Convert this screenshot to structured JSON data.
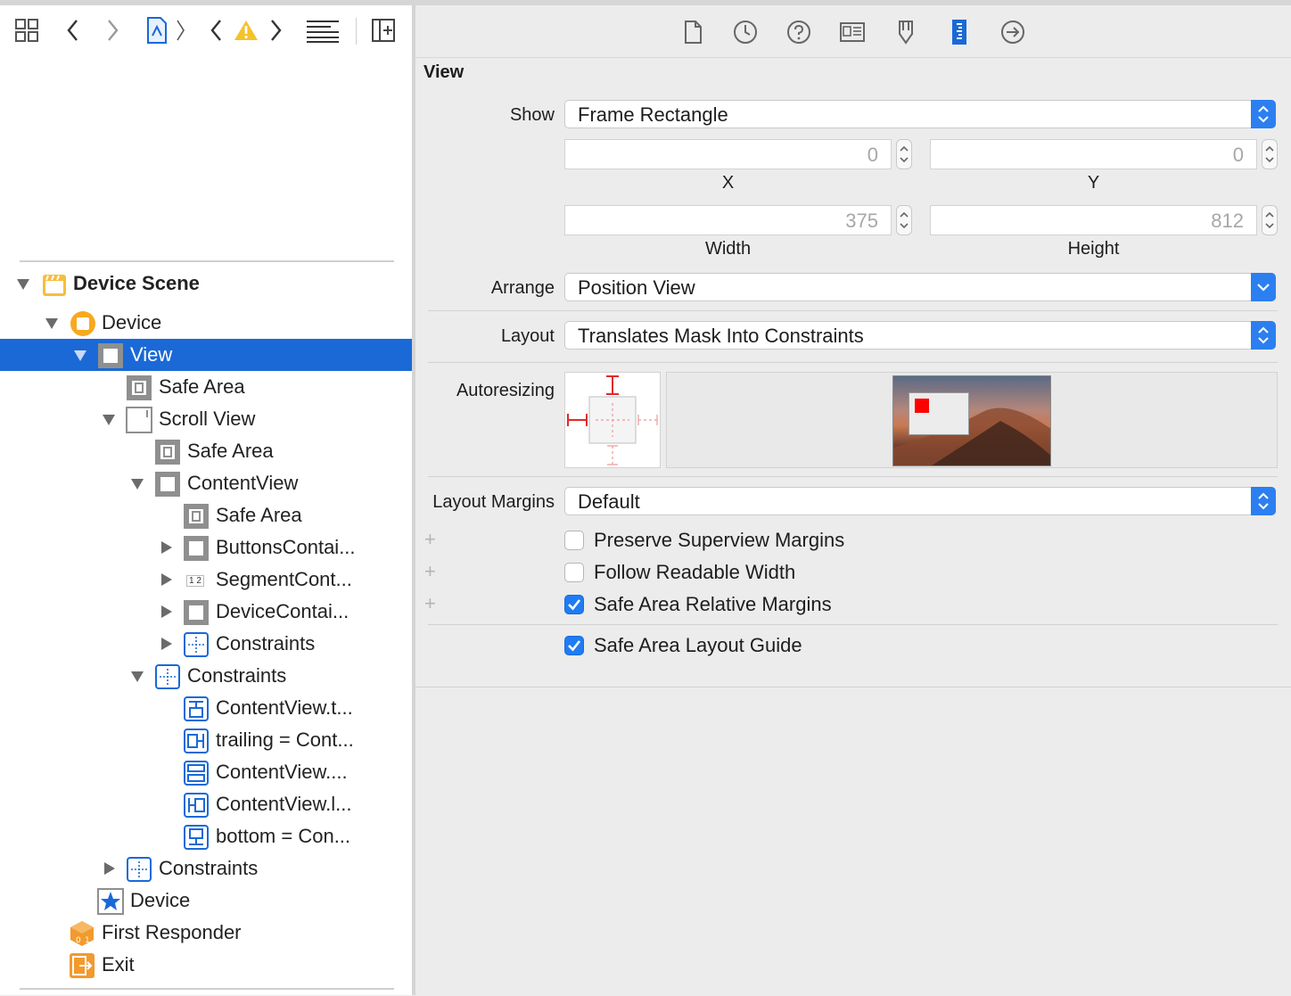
{
  "left_toolbar": {
    "icons": [
      "grid-icon",
      "back-chevron-icon",
      "forward-chevron-icon",
      "file-icon",
      "breadcrumb-chevron-icon",
      "issue-back-icon",
      "warning-icon",
      "issue-forward-icon",
      "lines-icon",
      "add-editor-icon"
    ]
  },
  "outline": {
    "items": [
      {
        "label": "Device Scene"
      },
      {
        "label": "Device"
      },
      {
        "label": "View"
      },
      {
        "label": "Safe Area"
      },
      {
        "label": "Scroll View"
      },
      {
        "label": "Safe Area"
      },
      {
        "label": "ContentView"
      },
      {
        "label": "Safe Area"
      },
      {
        "label": "ButtonsContai..."
      },
      {
        "label": "SegmentCont..."
      },
      {
        "label": "DeviceContai..."
      },
      {
        "label": "Constraints"
      },
      {
        "label": "Constraints"
      },
      {
        "label": "ContentView.t..."
      },
      {
        "label": "trailing = Cont..."
      },
      {
        "label": "ContentView...."
      },
      {
        "label": "ContentView.l..."
      },
      {
        "label": "bottom = Con..."
      },
      {
        "label": "Constraints"
      },
      {
        "label": "Device"
      },
      {
        "label": "First Responder"
      },
      {
        "label": "Exit"
      }
    ],
    "segment_icon_text": "1 2"
  },
  "inspector_toolbar": {
    "icons": [
      "file-inspector-icon",
      "history-icon",
      "help-icon",
      "identity-icon",
      "attributes-icon",
      "size-inspector-icon",
      "connections-icon"
    ],
    "active_color": "#1a69d6"
  },
  "size_inspector": {
    "section_title": "View",
    "show_label": "Show",
    "show_value": "Frame Rectangle",
    "x_value": "0",
    "y_value": "0",
    "x_caption": "X",
    "y_caption": "Y",
    "width_value": "375",
    "height_value": "812",
    "width_caption": "Width",
    "height_caption": "Height",
    "arrange_label": "Arrange",
    "arrange_value": "Position View",
    "layout_label": "Layout",
    "layout_value": "Translates Mask Into Constraints",
    "autoresizing_label": "Autoresizing",
    "layout_margins_label": "Layout Margins",
    "layout_margins_value": "Default",
    "checkboxes": [
      {
        "label": "Preserve Superview Margins",
        "checked": false
      },
      {
        "label": "Follow Readable Width",
        "checked": false
      },
      {
        "label": "Safe Area Relative Margins",
        "checked": true
      }
    ],
    "safe_area_guide": {
      "label": "Safe Area Layout Guide",
      "checked": true
    },
    "accent_color": "#1f7cf2",
    "strut_color": "#e0292b"
  }
}
